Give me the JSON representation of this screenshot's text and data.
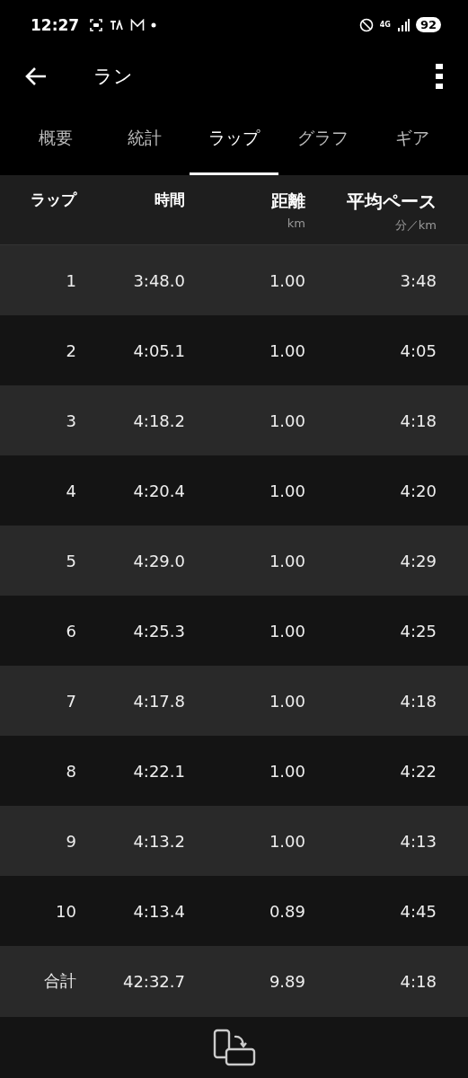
{
  "status_bar": {
    "time": "12:27",
    "network": "4G",
    "battery": "92"
  },
  "app_bar": {
    "title": "ラン"
  },
  "tabs": [
    {
      "label": "概要",
      "selected": false
    },
    {
      "label": "統計",
      "selected": false
    },
    {
      "label": "ラップ",
      "selected": true
    },
    {
      "label": "グラフ",
      "selected": false
    },
    {
      "label": "ギア",
      "selected": false
    }
  ],
  "table": {
    "columns": [
      {
        "label": "ラップ"
      },
      {
        "label": "時間"
      },
      {
        "label": "距離",
        "unit": "km"
      },
      {
        "label": "平均ペース",
        "unit": "分／km"
      }
    ],
    "rows": [
      [
        "1",
        "3:48.0",
        "1.00",
        "3:48"
      ],
      [
        "2",
        "4:05.1",
        "1.00",
        "4:05"
      ],
      [
        "3",
        "4:18.2",
        "1.00",
        "4:18"
      ],
      [
        "4",
        "4:20.4",
        "1.00",
        "4:20"
      ],
      [
        "5",
        "4:29.0",
        "1.00",
        "4:29"
      ],
      [
        "6",
        "4:25.3",
        "1.00",
        "4:25"
      ],
      [
        "7",
        "4:17.8",
        "1.00",
        "4:18"
      ],
      [
        "8",
        "4:22.1",
        "1.00",
        "4:22"
      ],
      [
        "9",
        "4:13.2",
        "1.00",
        "4:13"
      ],
      [
        "10",
        "4:13.4",
        "0.89",
        "4:45"
      ],
      [
        "合計",
        "42:32.7",
        "9.89",
        "4:18"
      ]
    ]
  }
}
